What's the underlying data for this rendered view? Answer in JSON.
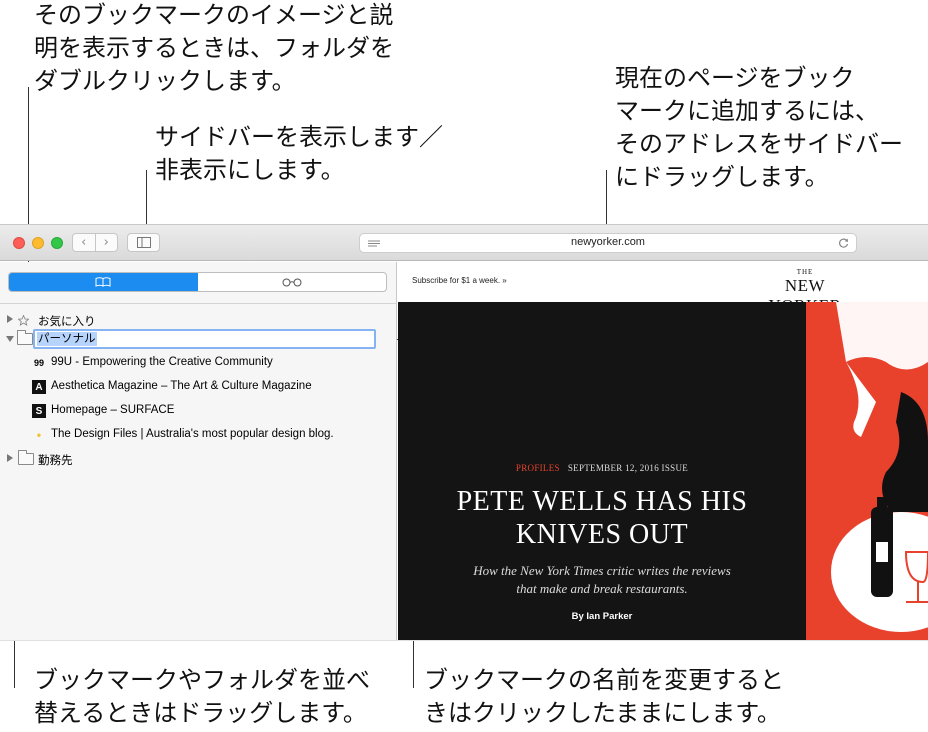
{
  "callouts": {
    "folder_double_click": [
      "そのブックマークのイメージと説",
      "明を表示するときは、フォルダを",
      "ダブルクリックします。"
    ],
    "sidebar_toggle": [
      "サイドバーを表示します／",
      "非表示にします。"
    ],
    "add_bookmark": [
      "現在のページをブック",
      "マークに追加するには、",
      "そのアドレスをサイドバー",
      "にドラッグします。"
    ],
    "reorder": [
      "ブックマークやフォルダを並べ",
      "替えるときはドラッグします。"
    ],
    "rename": [
      "ブックマークの名前を変更すると",
      "きはクリックしたままにします。"
    ]
  },
  "window": {
    "address": "newyorker.com",
    "colors": {
      "close": "#fc5f57",
      "minimize": "#fdbc2e",
      "zoom": "#33c748",
      "accent": "#1d8cf0"
    }
  },
  "sidebar": {
    "tabs": [
      {
        "icon": "book-icon",
        "selected": true
      },
      {
        "icon": "glasses-icon",
        "selected": false
      }
    ],
    "favorites_label": "お気に入り",
    "personal_folder_label": "パーソナル",
    "bookmarks": [
      {
        "favicon": "99",
        "label": "99U - Empowering the Creative Community"
      },
      {
        "favicon": "A",
        "label": "Aesthetica Magazine – The Art & Culture Magazine"
      },
      {
        "favicon": "S",
        "label": "Homepage – SURFACE"
      },
      {
        "favicon": "•",
        "label": "The Design Files | Australia's most popular design blog."
      }
    ],
    "work_folder_label": "勤務先"
  },
  "page": {
    "subscribe": "Subscribe for $1 a week. »",
    "logo_the": "THE",
    "logo_main": "NEW YORKER",
    "kicker_section": "PROFILES",
    "kicker_date": "SEPTEMBER 12, 2016 ISSUE",
    "headline_1": "PETE WELLS HAS HIS",
    "headline_2": "KNIVES OUT",
    "dek_1": "How the New York Times critic writes the reviews",
    "dek_2": "that make and break restaurants.",
    "byline": "By Ian Parker"
  }
}
